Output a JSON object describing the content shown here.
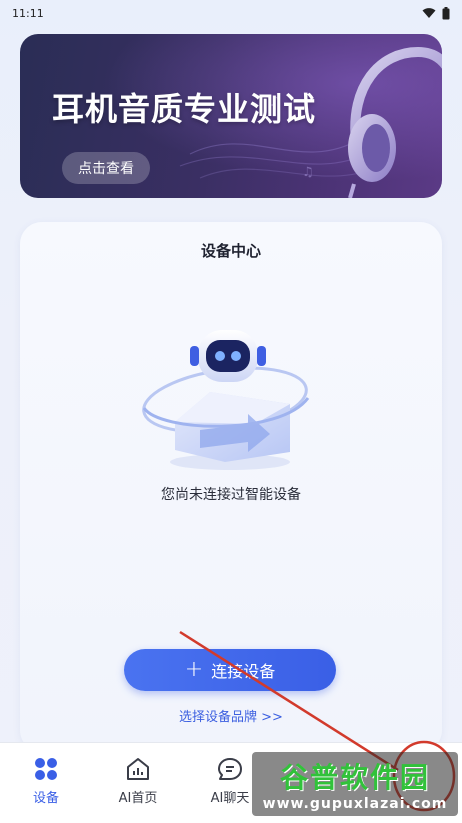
{
  "status_bar": {
    "time": "11:11"
  },
  "banner": {
    "title": "耳机音质专业测试",
    "button_label": "点击查看"
  },
  "device_center": {
    "title": "设备中心",
    "empty_message": "您尚未连接过智能设备",
    "connect_button_label": "连接设备",
    "brand_link_label": "选择设备品牌 >>"
  },
  "tab_bar": {
    "items": [
      {
        "label": "设备",
        "icon": "device-grid-icon",
        "active": true
      },
      {
        "label": "AI首页",
        "icon": "home-chart-icon",
        "active": false
      },
      {
        "label": "AI聊天",
        "icon": "chat-icon",
        "active": false
      }
    ]
  },
  "watermark": {
    "brand": "谷普软件园",
    "url": "www.gupuxlazai.com"
  },
  "colors": {
    "accent": "#3a5fe6",
    "banner_bg": "#3a2f63",
    "annotation": "#d23a2c",
    "watermark_green": "#31c23a"
  }
}
